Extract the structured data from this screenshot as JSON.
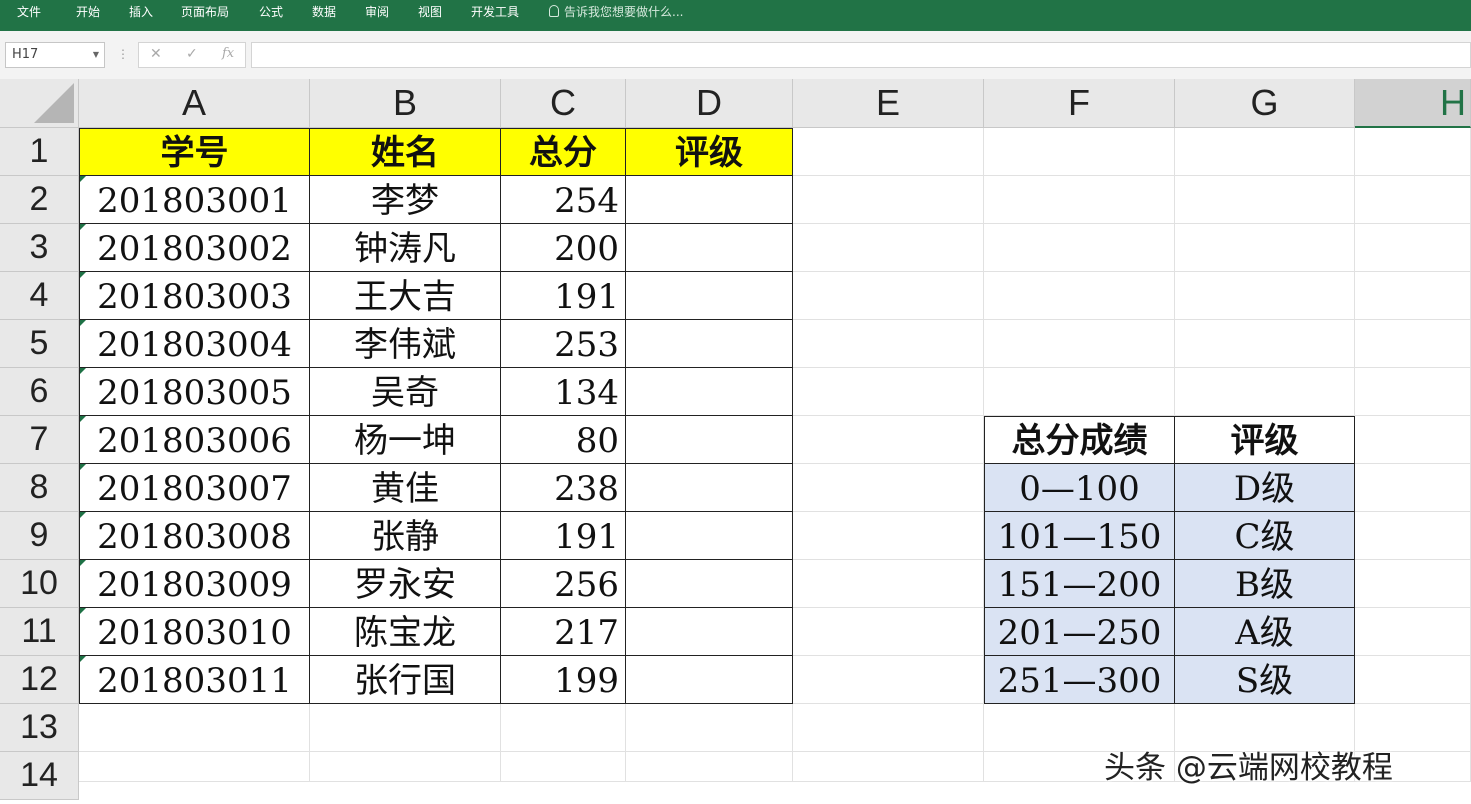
{
  "ribbon": {
    "tabs": [
      "文件",
      "开始",
      "插入",
      "页面布局",
      "公式",
      "数据",
      "审阅",
      "视图",
      "开发工具"
    ],
    "tell_me": "告诉我您想要做什么..."
  },
  "formula_bar": {
    "name_box": "H17",
    "cancel_icon": "✕",
    "enter_icon": "✓",
    "fx_label": "fx",
    "formula": ""
  },
  "columns": [
    "A",
    "B",
    "C",
    "D",
    "E",
    "F",
    "G",
    "H"
  ],
  "selected_column": "H",
  "rows": [
    "1",
    "2",
    "3",
    "4",
    "5",
    "6",
    "7",
    "8",
    "9",
    "10",
    "11",
    "12",
    "13",
    "14"
  ],
  "main_table": {
    "headers": [
      "学号",
      "姓名",
      "总分",
      "评级"
    ],
    "records": [
      [
        "201803001",
        "李梦",
        "254",
        ""
      ],
      [
        "201803002",
        "钟涛凡",
        "200",
        ""
      ],
      [
        "201803003",
        "王大吉",
        "191",
        ""
      ],
      [
        "201803004",
        "李伟斌",
        "253",
        ""
      ],
      [
        "201803005",
        "吴奇",
        "134",
        ""
      ],
      [
        "201803006",
        "杨一坤",
        "80",
        ""
      ],
      [
        "201803007",
        "黄佳",
        "238",
        ""
      ],
      [
        "201803008",
        "张静",
        "191",
        ""
      ],
      [
        "201803009",
        "罗永安",
        "256",
        ""
      ],
      [
        "201803010",
        "陈宝龙",
        "217",
        ""
      ],
      [
        "201803011",
        "张行国",
        "199",
        ""
      ]
    ],
    "header_color": "#ffff00"
  },
  "lookup_table": {
    "headers": [
      "总分成绩",
      "评级"
    ],
    "records": [
      [
        "0—100",
        "D级"
      ],
      [
        "101—150",
        "C级"
      ],
      [
        "151—200",
        "B级"
      ],
      [
        "201—250",
        "A级"
      ],
      [
        "251—300",
        "S级"
      ]
    ],
    "fill_color": "#dae3f3"
  },
  "watermark": "头条 @云端网校教程",
  "accent_color": "#217346"
}
